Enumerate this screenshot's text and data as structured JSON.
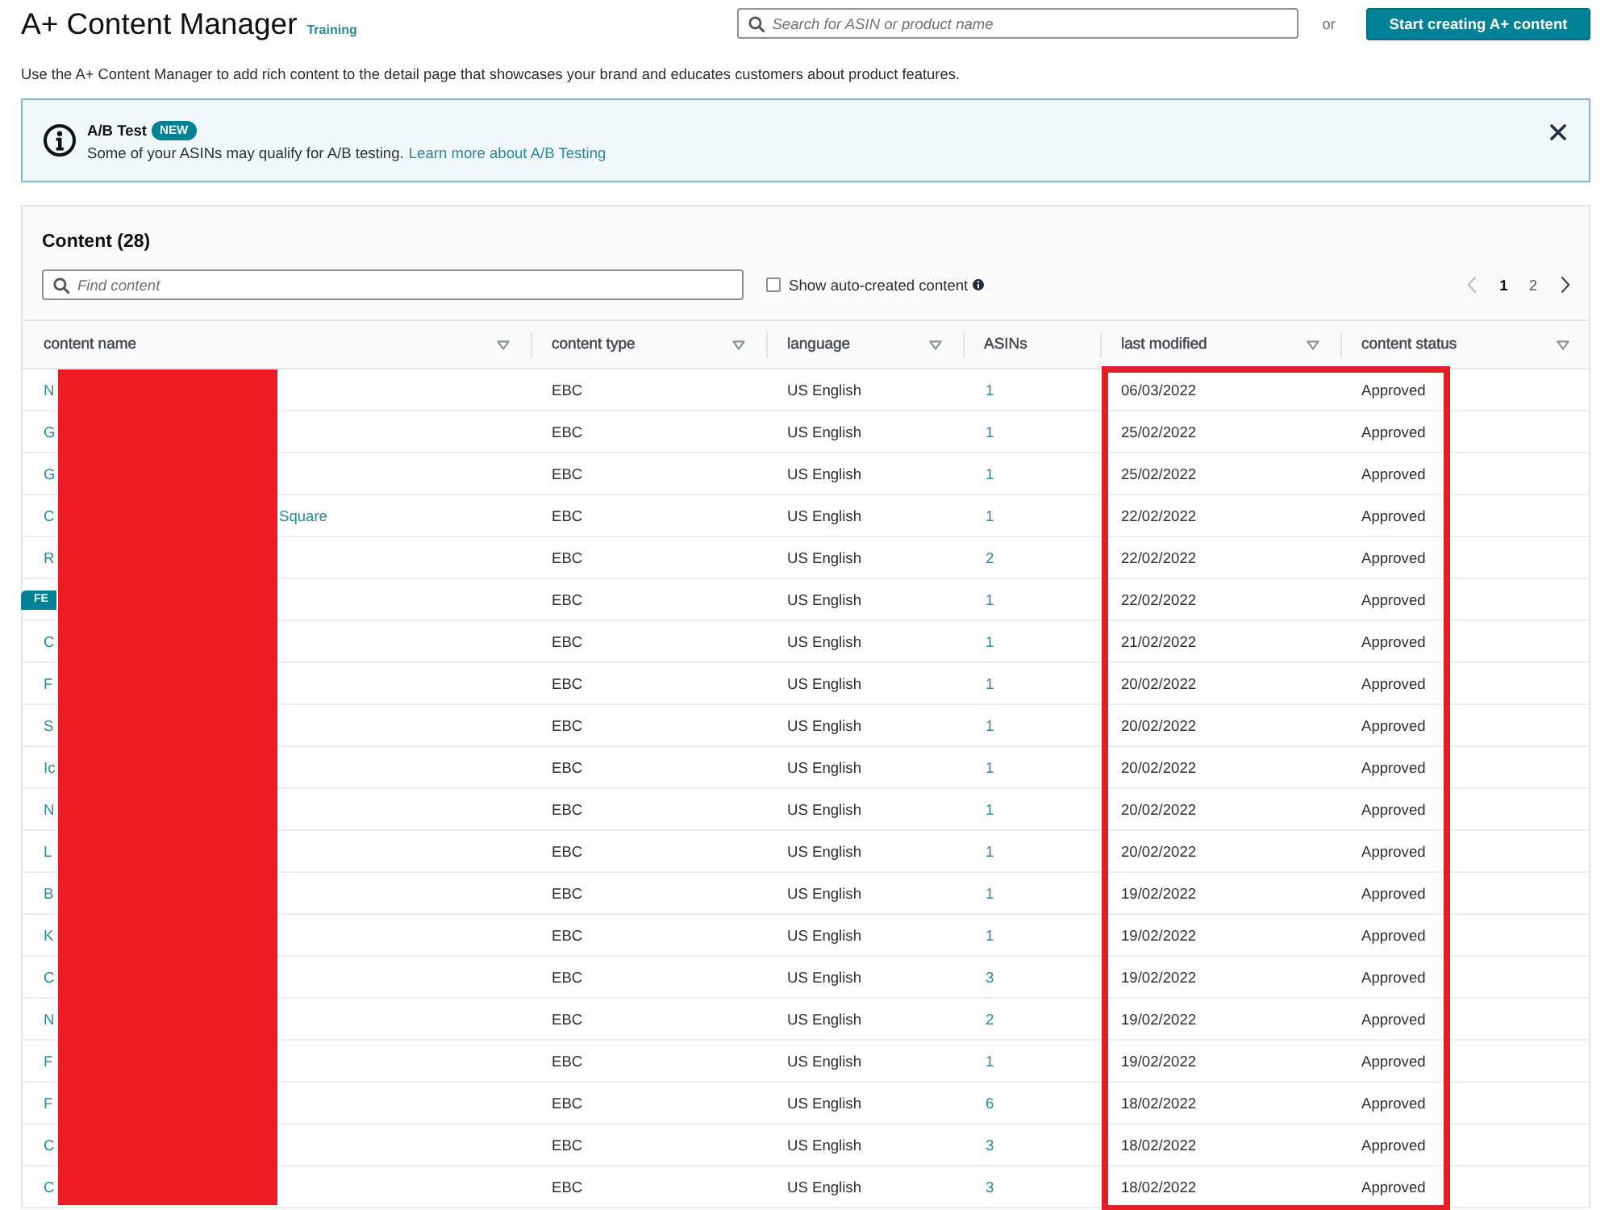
{
  "header": {
    "title": "A+ Content Manager",
    "training_link": "Training",
    "search": {
      "placeholder": "Search for ASIN or product name"
    },
    "separator": "or",
    "create_button": "Start creating A+ content"
  },
  "description": "Use the A+ Content Manager to add rich content to the detail page that showcases your brand and educates customers about product features.",
  "banner": {
    "title": "A/B Test",
    "badge": "NEW",
    "message": "Some of your ASINs may qualify for A/B testing.",
    "link": "Learn more about A/B Testing"
  },
  "content": {
    "title": "Content (28)",
    "search": {
      "placeholder": "Find content"
    },
    "auto_created": {
      "label": "Show auto-created content",
      "checked": false
    },
    "pagination": {
      "previous": {
        "disabled": true
      },
      "pages": [
        {
          "label": "1",
          "selected": true
        },
        {
          "label": "2",
          "selected": false
        }
      ],
      "next": {
        "disabled": false
      }
    },
    "table": {
      "columns": [
        {
          "label": "content name",
          "filter": true
        },
        {
          "label": "content type",
          "filter": true
        },
        {
          "label": "language",
          "filter": true
        },
        {
          "label": "ASINs",
          "filter": false
        },
        {
          "label": "last modified",
          "filter": true
        },
        {
          "label": "content status",
          "filter": true
        }
      ],
      "rows": [
        {
          "name": "N",
          "type": "EBC",
          "language": "US English",
          "asins": "1",
          "last_modified": "06/03/2022",
          "status": "Approved"
        },
        {
          "name": "G",
          "type": "EBC",
          "language": "US English",
          "asins": "1",
          "last_modified": "25/02/2022",
          "status": "Approved"
        },
        {
          "name": "G",
          "type": "EBC",
          "language": "US English",
          "asins": "1",
          "last_modified": "25/02/2022",
          "status": "Approved"
        },
        {
          "name": "C",
          "name_end": "Square",
          "type": "EBC",
          "language": "US English",
          "asins": "1",
          "last_modified": "22/02/2022",
          "status": "Approved"
        },
        {
          "name": "R",
          "type": "EBC",
          "language": "US English",
          "asins": "2",
          "last_modified": "22/02/2022",
          "status": "Approved"
        },
        {
          "badge": "FE",
          "type": "EBC",
          "language": "US English",
          "asins": "1",
          "last_modified": "22/02/2022",
          "status": "Approved"
        },
        {
          "name": "C",
          "type": "EBC",
          "language": "US English",
          "asins": "1",
          "last_modified": "21/02/2022",
          "status": "Approved"
        },
        {
          "name": "F",
          "type": "EBC",
          "language": "US English",
          "asins": "1",
          "last_modified": "20/02/2022",
          "status": "Approved"
        },
        {
          "name": "S",
          "type": "EBC",
          "language": "US English",
          "asins": "1",
          "last_modified": "20/02/2022",
          "status": "Approved"
        },
        {
          "name": "Ic",
          "type": "EBC",
          "language": "US English",
          "asins": "1",
          "last_modified": "20/02/2022",
          "status": "Approved"
        },
        {
          "name": "N",
          "type": "EBC",
          "language": "US English",
          "asins": "1",
          "last_modified": "20/02/2022",
          "status": "Approved"
        },
        {
          "name": "L",
          "type": "EBC",
          "language": "US English",
          "asins": "1",
          "last_modified": "20/02/2022",
          "status": "Approved"
        },
        {
          "name": "B",
          "type": "EBC",
          "language": "US English",
          "asins": "1",
          "last_modified": "19/02/2022",
          "status": "Approved"
        },
        {
          "name": "K",
          "type": "EBC",
          "language": "US English",
          "asins": "1",
          "last_modified": "19/02/2022",
          "status": "Approved"
        },
        {
          "name": "C",
          "type": "EBC",
          "language": "US English",
          "asins": "3",
          "last_modified": "19/02/2022",
          "status": "Approved"
        },
        {
          "name": "N",
          "type": "EBC",
          "language": "US English",
          "asins": "2",
          "last_modified": "19/02/2022",
          "status": "Approved"
        },
        {
          "name": "F",
          "type": "EBC",
          "language": "US English",
          "asins": "1",
          "last_modified": "19/02/2022",
          "status": "Approved"
        },
        {
          "name": "F",
          "type": "EBC",
          "language": "US English",
          "asins": "6",
          "last_modified": "18/02/2022",
          "status": "Approved"
        },
        {
          "name": "C",
          "type": "EBC",
          "language": "US English",
          "asins": "3",
          "last_modified": "18/02/2022",
          "status": "Approved"
        },
        {
          "name": "C",
          "type": "EBC",
          "language": "US English",
          "asins": "3",
          "last_modified": "18/02/2022",
          "status": "Approved"
        }
      ]
    }
  }
}
